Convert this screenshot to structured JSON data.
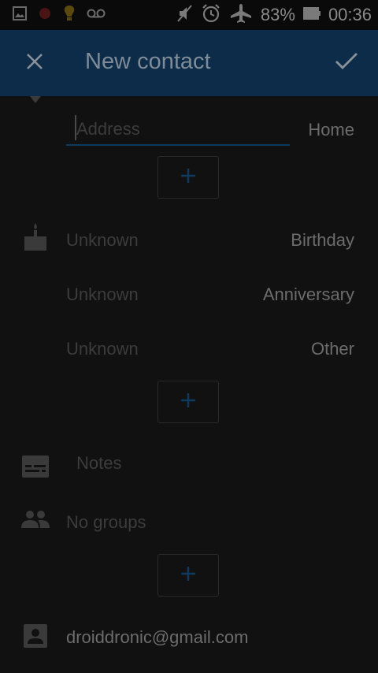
{
  "status_bar": {
    "battery": "83%",
    "time": "00:36",
    "icons": [
      "image-icon",
      "notification-dot-icon",
      "bulb-icon",
      "voicemail-icon",
      "mute-icon",
      "alarm-icon",
      "airplane-icon",
      "battery-icon"
    ]
  },
  "app_bar": {
    "title": "New contact",
    "close_icon": "close-icon",
    "save_icon": "check-icon"
  },
  "address": {
    "placeholder": "Address",
    "type": "Home"
  },
  "events": [
    {
      "value": "Unknown",
      "type": "Birthday"
    },
    {
      "value": "Unknown",
      "type": "Anniversary"
    },
    {
      "value": "Unknown",
      "type": "Other"
    }
  ],
  "notes": {
    "placeholder": "Notes"
  },
  "groups": {
    "value": "No groups"
  },
  "account": {
    "value": "droiddronic@gmail.com"
  },
  "colors": {
    "app_bar": "#0c2c4a",
    "accent": "#0d3a60",
    "background": "#111111"
  }
}
